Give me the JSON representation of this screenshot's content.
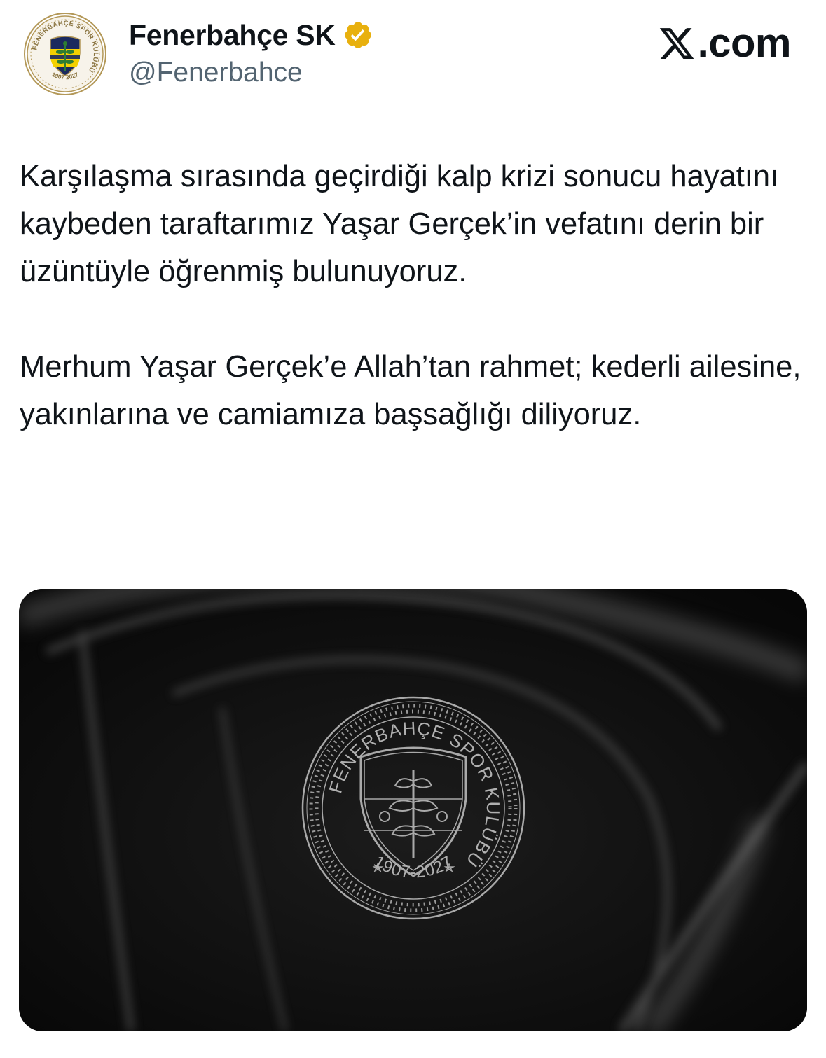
{
  "account": {
    "display_name": "Fenerbahçe SK",
    "handle": "@Fenerbahce",
    "verified": true,
    "badge_color": "#E8B00E"
  },
  "avatar": {
    "ring_text": "FENERBAHÇE SPOR KULÜBÜ",
    "years": "1907-2027",
    "colors": {
      "gold": "#B39858",
      "navy": "#1B2A5E",
      "yellow": "#F4D000"
    }
  },
  "brand": {
    "label": ".com",
    "icon": "x-logo-icon"
  },
  "tweet": {
    "paragraphs": [
      "Karşılaşma sırasında geçirdiği kalp krizi sonucu hayatını kaybeden taraftarımız Yaşar Gerçek’in vefatını derin bir üzüntüyle öğrenmiş bulunuyoruz.",
      "Merhum Yaşar Gerçek’e Allah’tan rahmet; kederli ailesine, yakınlarına ve camiamıza başsağlığı diliyoruz."
    ]
  },
  "media": {
    "emblem_ring_text": "FENERBAHÇE SPOR KULÜBÜ",
    "emblem_years": "1907-2027",
    "background": "#0b0b0b"
  }
}
